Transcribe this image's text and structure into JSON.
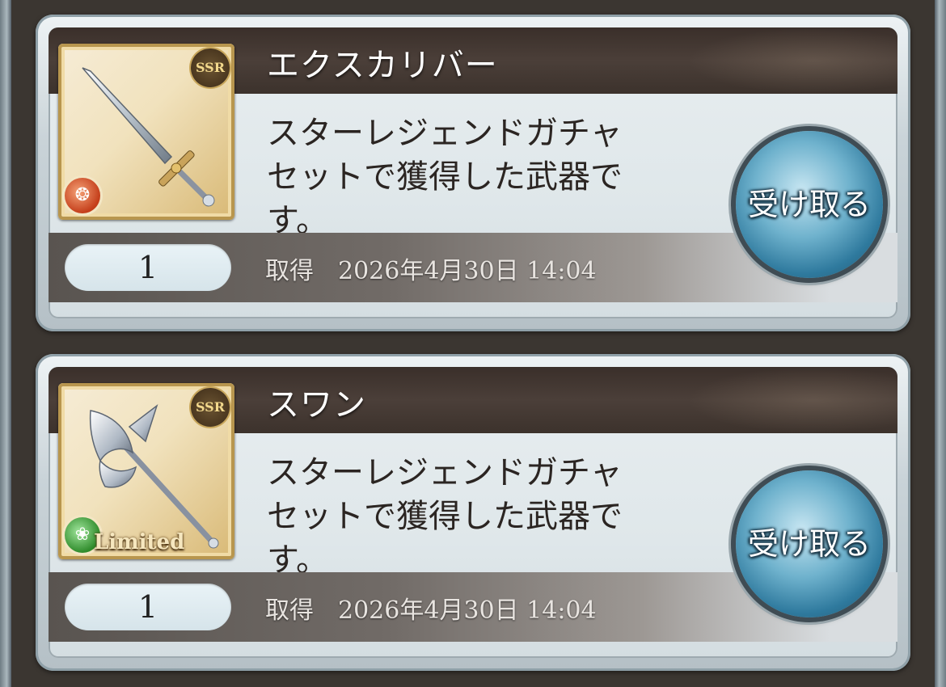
{
  "items": [
    {
      "name": "エクスカリバー",
      "description_lines": [
        "スターレジェンドガチャ",
        "セットで獲得した武器で",
        "す。"
      ],
      "count": "1",
      "acquired_label": "取得",
      "acquired_date": "2026年4月30日 14:04",
      "rarity": "SSR",
      "element": "fire",
      "element_icon": "fire-element-icon",
      "limited": "",
      "weapon_icon": "sword-icon",
      "button_label": "受け取る"
    },
    {
      "name": "スワン",
      "description_lines": [
        "スターレジェンドガチャ",
        "セットで獲得した武器で",
        "す。"
      ],
      "count": "1",
      "acquired_label": "取得",
      "acquired_date": "2026年4月30日 14:04",
      "rarity": "SSR",
      "element": "wind",
      "element_icon": "wind-element-icon",
      "limited": "Limited",
      "weapon_icon": "halberd-icon",
      "button_label": "受け取る"
    }
  ],
  "colors": {
    "title_bar": "#3a2f2a",
    "button_blue": "#2f7a9e",
    "card_frame": "#8fa0a8"
  }
}
